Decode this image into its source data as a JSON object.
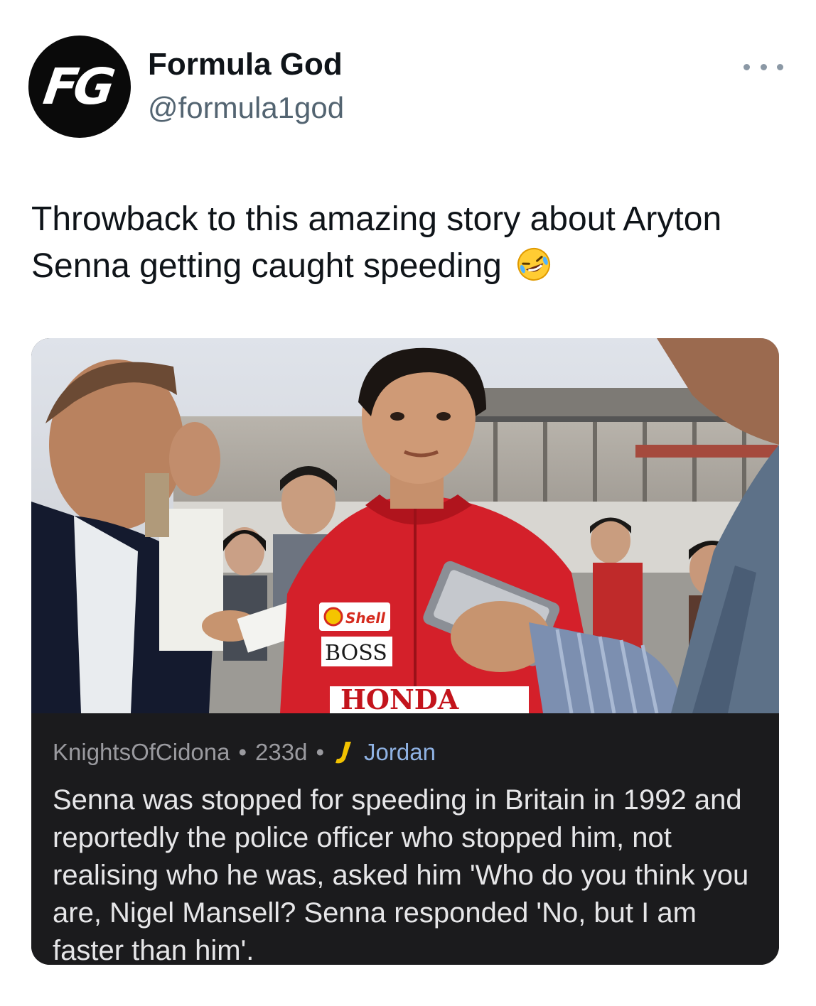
{
  "author": {
    "avatar_text": "FG",
    "display_name": "Formula God",
    "handle": "@formula1god"
  },
  "more_icon": "more-horizontal-icon",
  "tweet": {
    "text": "Throwback to this amazing story about Aryton Senna getting caught speeding",
    "emoji": "rolling-on-the-floor-laughing-emoji"
  },
  "media": {
    "photo_logos": {
      "sponsor_1": "Shell",
      "sponsor_2": "BOSS",
      "sponsor_3": "HONDA"
    },
    "post": {
      "username": "KnightsOfCidona",
      "separator": "•",
      "age": "233d",
      "flair_icon": "jordan-flair-icon",
      "flair": "Jordan",
      "body": "Senna  was stopped for speeding in Britain in 1992 and reportedly the police officer who stopped him, not realising who he was, asked him 'Who do you think you are, Nigel Mansell? Senna responded 'No, but I am faster than him'."
    }
  },
  "colors": {
    "text_primary": "#0f1419",
    "text_secondary": "#536471",
    "card_bg": "#1b1b1d",
    "suit_red": "#d4202a",
    "flair_blue": "#8fb2e3",
    "flair_yellow": "#f2c200"
  }
}
